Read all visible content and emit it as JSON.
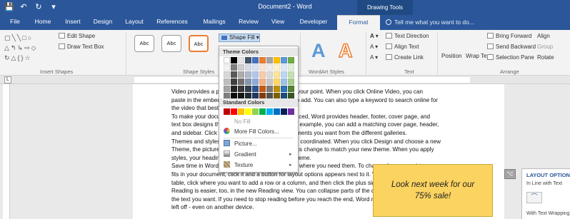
{
  "titlebar": {
    "doc_title": "Document2 - Word",
    "context_tab_group": "Drawing Tools",
    "qat": [
      "save-icon",
      "undo-icon",
      "redo-icon",
      "customize-icon"
    ]
  },
  "tabs": [
    "File",
    "Home",
    "Insert",
    "Design",
    "Layout",
    "References",
    "Mailings",
    "Review",
    "View",
    "Developer",
    "Format"
  ],
  "tell_me": "Tell me what you want to do...",
  "ribbon": {
    "insert_shapes": {
      "label": "Insert Shapes",
      "edit_shape": "Edit Shape",
      "draw_text_box": "Draw Text Box"
    },
    "shape_styles": {
      "label": "Shape Styles",
      "style_samples": [
        "Abc",
        "Abc",
        "Abc"
      ],
      "shape_fill": "Shape Fill"
    },
    "wordart": {
      "label": "WordArt Styles",
      "sample": "A"
    },
    "text": {
      "label": "Text",
      "text_direction": "Text Direction",
      "align_text": "Align Text",
      "create_link": "Create Link"
    },
    "arrange": {
      "label": "Arrange",
      "position": "Position",
      "wrap_text": "Wrap Text",
      "bring_forward": "Bring Forward",
      "send_backward": "Send Backward",
      "selection_pane": "Selection Pane",
      "align": "Align",
      "group": "Group",
      "rotate": "Rotate"
    }
  },
  "color_menu": {
    "theme_header": "Theme Colors",
    "standard_header": "Standard Colors",
    "theme_colors": [
      [
        "#ffffff",
        "#000000",
        "#e7e6e6",
        "#44546a",
        "#4472c4",
        "#ed7d31",
        "#a5a5a5",
        "#ffc000",
        "#5b9bd5",
        "#70ad47"
      ],
      [
        "#f2f2f2",
        "#7f7f7f",
        "#d0cece",
        "#d6dce4",
        "#d9e2f3",
        "#fbe5d5",
        "#ededed",
        "#fff2cc",
        "#deebf6",
        "#e2efd9"
      ],
      [
        "#d8d8d8",
        "#595959",
        "#aeabab",
        "#adb9ca",
        "#b4c6e7",
        "#f7cbac",
        "#dbdbdb",
        "#fee599",
        "#bdd7ee",
        "#c5e0b3"
      ],
      [
        "#bfbfbf",
        "#3f3f3f",
        "#757070",
        "#8496b0",
        "#8eaadb",
        "#f4b183",
        "#c9c9c9",
        "#ffd965",
        "#9cc3e5",
        "#a8d08d"
      ],
      [
        "#a5a5a5",
        "#262626",
        "#3a3838",
        "#323f4f",
        "#2f5496",
        "#c55a11",
        "#7b7b7b",
        "#bf9000",
        "#2e75b5",
        "#538135"
      ],
      [
        "#7f7f7f",
        "#0c0c0c",
        "#171616",
        "#222a35",
        "#1f3864",
        "#833c0b",
        "#525252",
        "#7f6000",
        "#1e4e79",
        "#375623"
      ]
    ],
    "standard_colors": [
      "#c00000",
      "#ff0000",
      "#ffc000",
      "#ffff00",
      "#92d050",
      "#00b050",
      "#00b0f0",
      "#0070c0",
      "#002060",
      "#7030a0"
    ],
    "items": {
      "no_fill": "No Fill",
      "more_fill": "More Fill Colors...",
      "picture": "Picture...",
      "gradient": "Gradient",
      "texture": "Texture"
    }
  },
  "document": {
    "lines": [
      "Video provides a powerful way to help you prove your point. When you click Online Video, you can",
      "paste in the embed code for the video you want to add. You can also type a keyword to search online for",
      "the video that best fits your document.",
      "To make your document look professionally produced, Word provides header, footer, cover page, and",
      "text box designs that complement each other. For example, you can add a matching cover page, header,",
      "and sidebar. Click Insert and then choose the elements you want from the different galleries.",
      "Themes and styles also help keep your document coordinated. When you click Design and choose a new",
      "Theme, the pictures, charts, and SmartArt graphics change to match your new theme. When you apply",
      "styles, your headings change to match the new theme.",
      "Save time in Word with new buttons that show up where you need them. To change the way a picture",
      "fits in your document, click it and a button for layout options appears next to it. When you work on a",
      "table, click where you want to add a row or a column, and then click the plus sign.",
      "Reading is easier, too, in the new Reading view. You can collapse parts of the document and focus on",
      "the text you want. If you need to stop reading before you reach the end, Word remembers where you",
      "left off - even on another device."
    ],
    "callout_text": "Look next week for our 75% sale!"
  },
  "layout_options": {
    "title": "LAYOUT OPTIONS",
    "in_line": "In Line with Text",
    "with_wrapping": "With Text Wrapping"
  },
  "colors": {
    "word_blue": "#2b579a",
    "callout_fill": "#fbd360",
    "wordart_blue": "#5b9bd5",
    "wordart_orange": "#ed7d31"
  }
}
